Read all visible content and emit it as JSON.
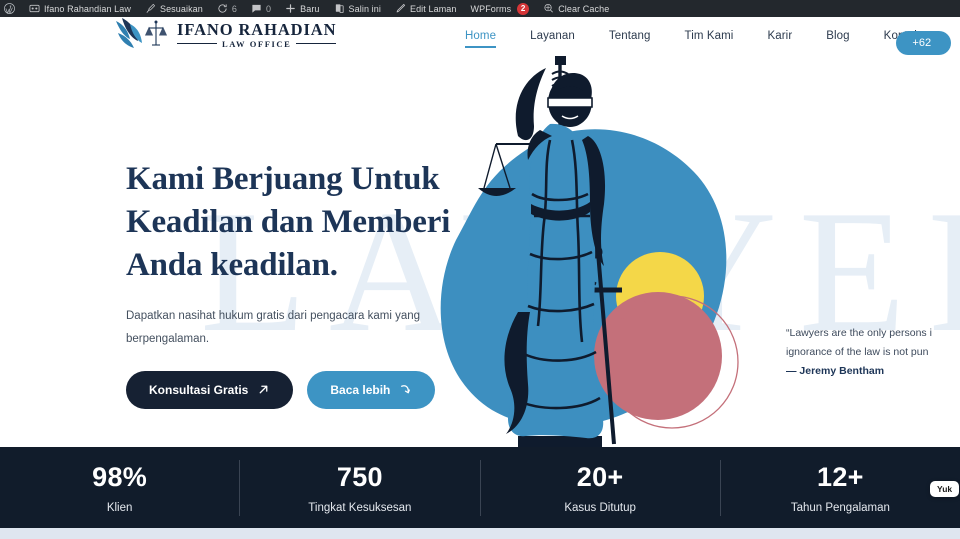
{
  "adminbar": {
    "items": [
      {
        "icon": "wordpress-logo-icon",
        "label": ""
      },
      {
        "icon": "home-dashboard-icon",
        "label": "Ifano Rahandian Law"
      },
      {
        "icon": "customize-brush-icon",
        "label": "Sesuaikan"
      },
      {
        "icon": "update-refresh-icon",
        "label": "",
        "count": "6"
      },
      {
        "icon": "comment-bubble-icon",
        "label": "",
        "count": "0"
      },
      {
        "icon": "plus-new-icon",
        "label": "Baru"
      },
      {
        "icon": "duplicate-pages-icon",
        "label": "Salin ini"
      },
      {
        "icon": "edit-pencil-icon",
        "label": "Edit Laman"
      },
      {
        "icon": "wpforms-icon",
        "label": "WPForms",
        "badge": "2"
      },
      {
        "icon": "cache-broom-icon",
        "label": "Clear Cache"
      }
    ]
  },
  "header": {
    "logo": {
      "name": "IFANO RAHADIAN",
      "subtitle": "LAW OFFICE",
      "mark": "scales-of-justice-eagle-logo-icon"
    },
    "nav": [
      {
        "label": "Home",
        "active": true
      },
      {
        "label": "Layanan",
        "active": false
      },
      {
        "label": "Tentang",
        "active": false
      },
      {
        "label": "Tim Kami",
        "active": false
      },
      {
        "label": "Karir",
        "active": false
      },
      {
        "label": "Blog",
        "active": false
      },
      {
        "label": "Kontak",
        "active": false
      }
    ],
    "phone_button": "+62"
  },
  "hero": {
    "watermark": "LAWYERS",
    "title_lines": [
      "Kami Berjuang Untuk",
      "Keadilan dan Memberi",
      "Anda keadilan."
    ],
    "subtitle": "Dapatkan nasihat hukum gratis dari pengacara kami yang berpengalaman.",
    "primary_button": {
      "label": "Konsultasi Gratis",
      "icon": "arrow-up-right-icon"
    },
    "secondary_button": {
      "label": "Baca lebih",
      "icon": "curved-arrow-icon"
    },
    "quote": {
      "line1": "“Lawyers are the only persons i",
      "line2": "ignorance of the law is not pun",
      "author": "— Jeremy Bentham"
    },
    "illustration": "lady-justice-statue-illustration",
    "colors": {
      "blue_blob": "#3d8fc0",
      "yellow_circle": "#f4d748",
      "red_circle": "#c4707a",
      "statue_dark": "#0f1b2d",
      "statue_blue": "#3d8fc0"
    }
  },
  "stats": [
    {
      "value": "98%",
      "label": "Klien"
    },
    {
      "value": "750",
      "label": "Tingkat Kesuksesan"
    },
    {
      "value": "20+",
      "label": "Kasus Ditutup"
    },
    {
      "value": "12+",
      "label": "Tahun Pengalaman"
    }
  ],
  "chat_widget": {
    "label": "Yuk"
  },
  "theme": {
    "navy": "#1d3557",
    "accent_blue": "#3d94c4",
    "dark_bar": "#111c2b",
    "adminbar_bg": "#23282d"
  }
}
